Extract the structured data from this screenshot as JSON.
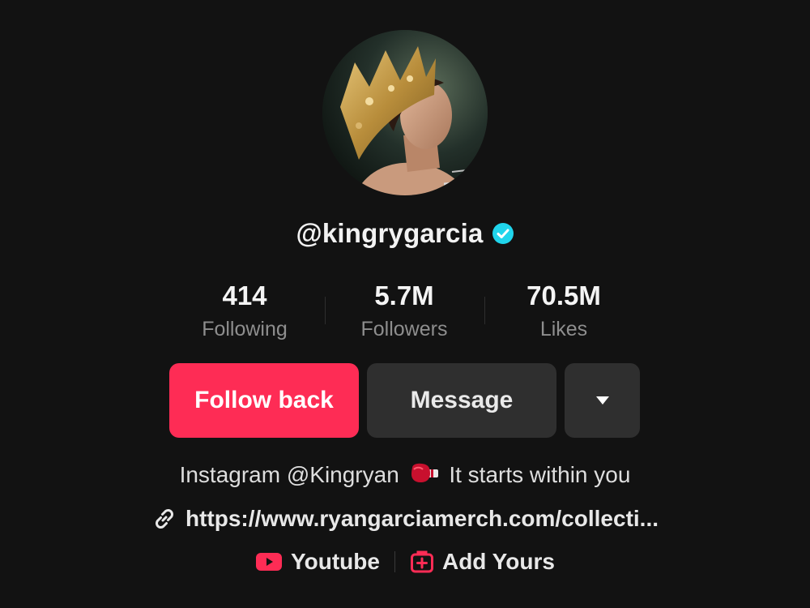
{
  "profile": {
    "username": "@kingrygarcia",
    "verified": true,
    "avatar_icon": "profile-photo-crowned-boxer"
  },
  "stats": [
    {
      "value": "414",
      "label": "Following"
    },
    {
      "value": "5.7M",
      "label": "Followers"
    },
    {
      "value": "70.5M",
      "label": "Likes"
    }
  ],
  "actions": {
    "follow_label": "Follow back",
    "message_label": "Message",
    "dropdown_icon": "caret-down-icon"
  },
  "bio": {
    "text_before": "Instagram @Kingryan",
    "emoji_icon": "boxing-glove-icon",
    "text_after": "It starts within you"
  },
  "link": {
    "icon": "link-icon",
    "text": "https://www.ryangarciamerch.com/collecti..."
  },
  "extras": {
    "youtube_label": "Youtube",
    "add_yours_label": "Add Yours"
  },
  "colors": {
    "background": "#121212",
    "accent": "#fe2c55",
    "verified": "#20d5ec",
    "button_secondary": "#2f2f2f"
  }
}
